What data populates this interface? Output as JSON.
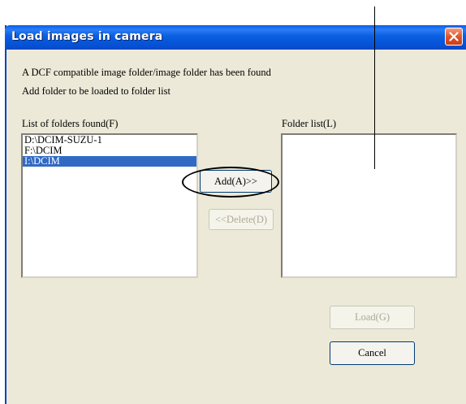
{
  "window": {
    "title": "Load images in camera"
  },
  "messages": {
    "line1": "A DCF compatible image folder/image folder has been found",
    "line2": "Add folder to be loaded to folder list"
  },
  "found_list": {
    "label": "List of folders found(F)",
    "items": [
      {
        "text": "D:\\DCIM-SUZU-1",
        "selected": false
      },
      {
        "text": "F:\\DCIM",
        "selected": false
      },
      {
        "text": "I:\\DCIM",
        "selected": true
      }
    ]
  },
  "folder_list": {
    "label": "Folder list(L)",
    "items": []
  },
  "buttons": {
    "add": "Add(A)>>",
    "delete": "<<Delete(D)",
    "load": "Load(G)",
    "cancel": "Cancel"
  },
  "icons": {
    "close": "close-icon"
  },
  "colors": {
    "titlebar": "#0a5ee8",
    "selection": "#316ac5",
    "dialog_bg": "#ece9d8",
    "close_button": "#e2532b"
  }
}
